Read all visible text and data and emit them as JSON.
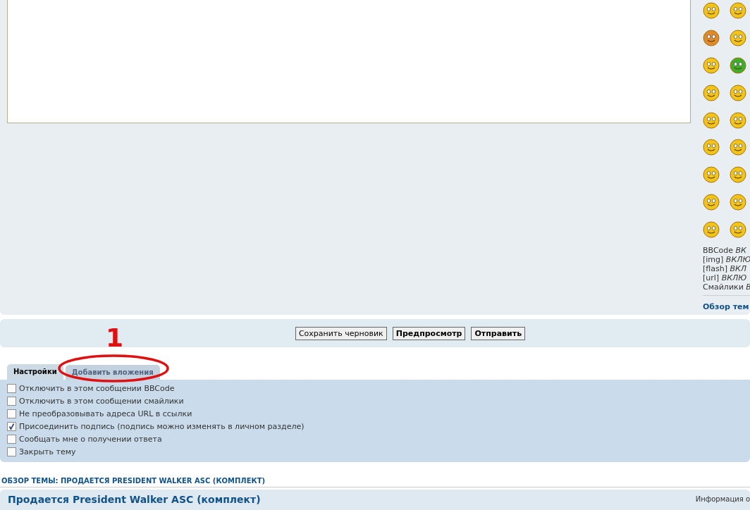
{
  "side_panel": {
    "bbcode_status": [
      "BBCode *ВК*",
      "[img] *ВКЛЮ*",
      "[flash] *ВКЛ*",
      "[url] *ВКЛЮ*",
      "Смайлики *В*"
    ],
    "link": "Обзор тем"
  },
  "buttons": [
    {
      "label": "Сохранить черновик",
      "primary": false
    },
    {
      "label": "Предпросмотр",
      "primary": true
    },
    {
      "label": "Отправить",
      "primary": true
    }
  ],
  "annotation": {
    "label": "1"
  },
  "tabs": [
    {
      "label": "Настройки",
      "selected": true
    },
    {
      "label": "Добавить вложения",
      "selected": false
    }
  ],
  "options": [
    {
      "label": "Отключить в этом сообщении BBCode",
      "checked": false
    },
    {
      "label": "Отключить в этом сообщении смайлики",
      "checked": false
    },
    {
      "label": "Не преобразовывать адреса URL в ссылки",
      "checked": false
    },
    {
      "label": "Присоединить подпись (подпись можно изменять в личном разделе)",
      "checked": true
    },
    {
      "label": "Сообщать мне о получении ответа",
      "checked": false
    },
    {
      "label": "Закрыть тему",
      "checked": false
    }
  ],
  "topic_review": {
    "heading": "ОБЗОР ТЕМЫ: ПРОДАЕТСЯ PRESIDENT WALKER ASC (КОМПЛЕКТ)",
    "title": "Продается President Walker ASC (комплект)",
    "info": "Информация о"
  }
}
